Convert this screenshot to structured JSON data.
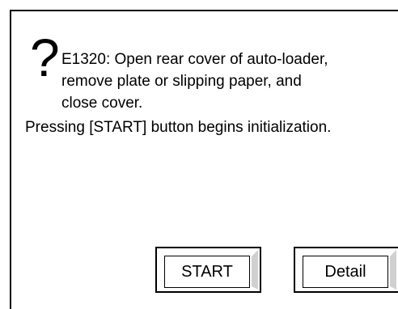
{
  "dialog": {
    "icon": "question-mark-icon",
    "icon_glyph": "?",
    "message_lines": [
      "E1320: Open rear cover of auto-loader,",
      "remove plate or slipping paper, and",
      "close cover.",
      "Pressing [START] button begins initialization."
    ]
  },
  "buttons": {
    "start_label": "START",
    "detail_label": "Detail"
  }
}
